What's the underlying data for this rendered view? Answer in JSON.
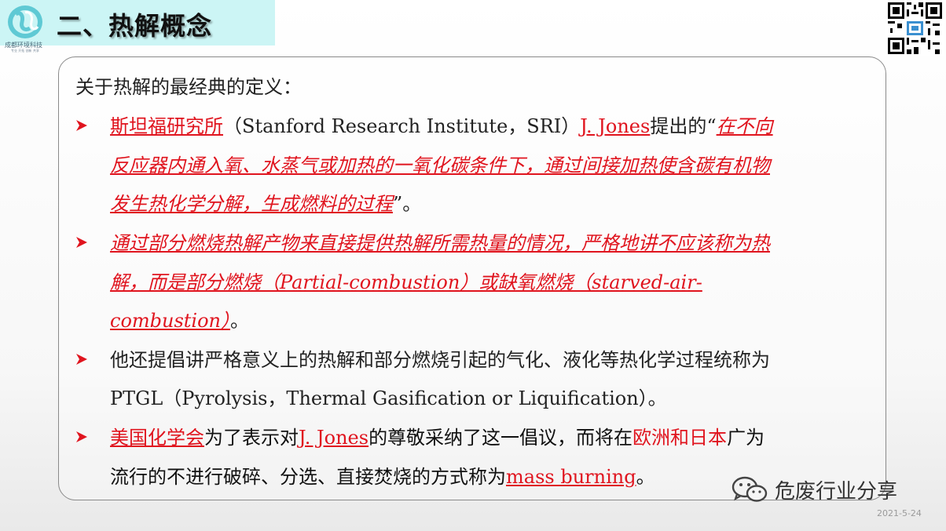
{
  "header": {
    "title": "二、热解概念",
    "logo_text": "成都环境科技",
    "logo_sub": "专业 开拓 创新 共享"
  },
  "content": {
    "intro": "关于热解的最经典的定义：",
    "b1": {
      "org": "斯坦福研究所",
      "org_en": "（Stanford Research Institute，SRI）",
      "person": "J. Jones",
      "proposed": "提出的“",
      "quote_l1": "在不向",
      "quote_l2": "反应器内通入氧、水蒸气或加热的一氧化碳条件下，通过间接加热使含碳有机物",
      "quote_l3": "发生热化学分解，生成燃料的过程",
      "end": "”。"
    },
    "b2": {
      "l1": "通过部分燃烧热解产物来直接提供热解所需热量的情况，严格地讲不应该称为热",
      "l2": "解，而是部分燃烧（Partial-combustion）或缺氧燃烧（starved-air-",
      "l3": "combustion）",
      "end": "。"
    },
    "b3": {
      "l1": "他还提倡讲严格意义上的热解和部分燃烧引起的气化、液化等热化学过程统称为",
      "l2": "PTGL（Pyrolysis，Thermal Gasification or  Liquification）。"
    },
    "b4": {
      "org": "美国化学会",
      "t1": "为了表示对",
      "person": "J. Jones",
      "t2": "的尊敬采纳了这一倡议，而将在",
      "region": "欧洲和日本",
      "t3": "广为",
      "l2a": "流行的不进行破碎、分选、直接焚烧的方式称为",
      "term": "mass burning",
      "end": "。"
    }
  },
  "watermark": "危废行业分享",
  "footer": {
    "date": "2021-5-24"
  },
  "colors": {
    "accent": "#e0141e",
    "header_bg": "#ccf5f5"
  },
  "icons": {
    "bullet": "arrow-bullet-icon",
    "wechat": "wechat-icon",
    "qr": "qr-code-icon"
  }
}
